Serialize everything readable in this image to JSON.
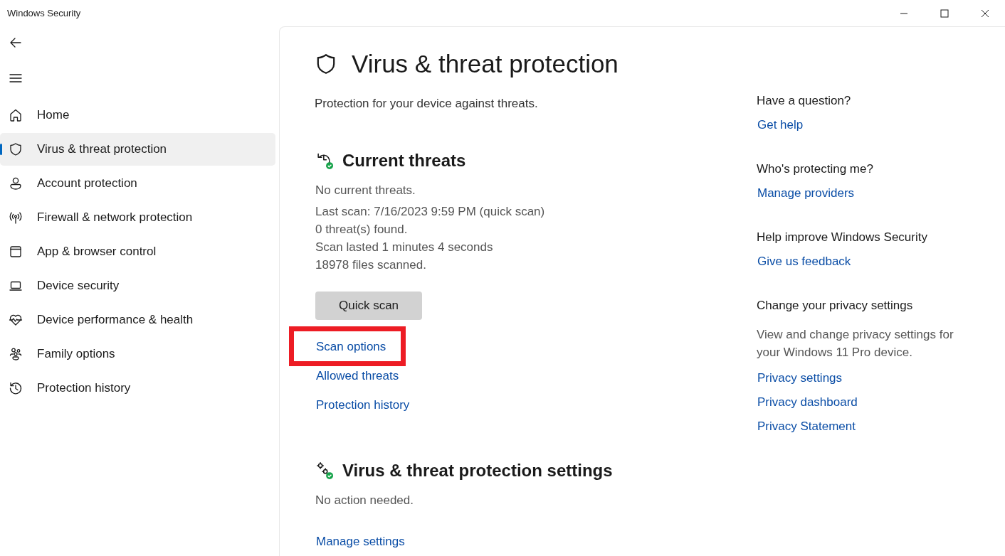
{
  "window": {
    "title": "Windows Security"
  },
  "sidebar": {
    "items": [
      {
        "label": "Home",
        "selected": false
      },
      {
        "label": "Virus & threat protection",
        "selected": true
      },
      {
        "label": "Account protection",
        "selected": false
      },
      {
        "label": "Firewall & network protection",
        "selected": false
      },
      {
        "label": "App & browser control",
        "selected": false
      },
      {
        "label": "Device security",
        "selected": false
      },
      {
        "label": "Device performance & health",
        "selected": false
      },
      {
        "label": "Family options",
        "selected": false
      },
      {
        "label": "Protection history",
        "selected": false
      }
    ]
  },
  "page": {
    "title": "Virus & threat protection",
    "subtitle": "Protection for your device against threats."
  },
  "current_threats": {
    "heading": "Current threats",
    "status": "No current threats.",
    "details": [
      "Last scan: 7/16/2023 9:59 PM (quick scan)",
      "0 threat(s) found.",
      "Scan lasted 1 minutes 4 seconds",
      "18978 files scanned."
    ],
    "button": "Quick scan",
    "links": [
      {
        "label": "Scan options",
        "highlighted": true
      },
      {
        "label": "Allowed threats",
        "highlighted": false
      },
      {
        "label": "Protection history",
        "highlighted": false
      }
    ]
  },
  "settings": {
    "heading": "Virus & threat protection settings",
    "status": "No action needed.",
    "links": [
      {
        "label": "Manage settings",
        "highlighted": false
      }
    ]
  },
  "aside": {
    "sections": [
      {
        "heading": "Have a question?",
        "links": [
          "Get help"
        ]
      },
      {
        "heading": "Who's protecting me?",
        "links": [
          "Manage providers"
        ]
      },
      {
        "heading": "Help improve Windows Security",
        "links": [
          "Give us feedback"
        ]
      },
      {
        "heading": "Change your privacy settings",
        "text": "View and change privacy settings for your Windows 11 Pro device.",
        "links": [
          "Privacy settings",
          "Privacy dashboard",
          "Privacy Statement"
        ]
      }
    ]
  }
}
